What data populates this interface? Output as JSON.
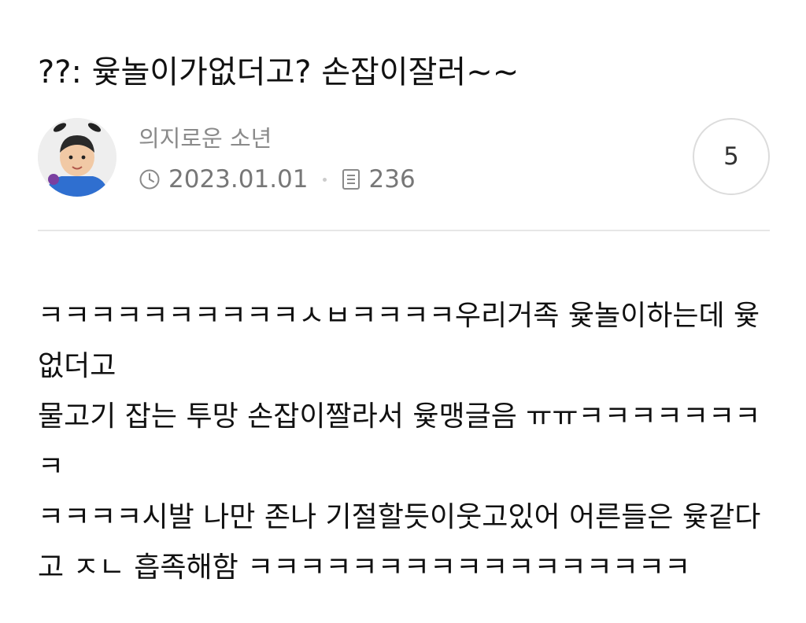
{
  "post": {
    "title": "??: 윷놀이가없더고? 손잡이잘러~~",
    "author": {
      "name": "의지로운 소년"
    },
    "date": "2023.01.01",
    "views": "236",
    "comment_count": "5",
    "body": [
      "ㅋㅋㅋㅋㅋㅋㅋㅋㅋㅋㅅㅂㅋㅋㅋㅋ우리거족 윷놀이하는데 윷없더고",
      "물고기 잡는 투망 손잡이짤라서 윷맹글음 ㅠㅠㅋㅋㅋㅋㅋㅋㅋㅋ",
      "ㅋㅋㅋㅋ시발 나만 존나 기절할듯이웃고있어 어른들은 윷같다고 ㅈㄴ 흡족해함 ㅋㅋㅋㅋㅋㅋㅋㅋㅋㅋㅋㅋㅋㅋㅋㅋㅋ"
    ]
  },
  "icons": {
    "date": "clock-icon",
    "views": "document-icon"
  },
  "colors": {
    "background": "#ffffff",
    "text": "#111111",
    "meta": "#777777",
    "divider": "#e6e6e6"
  }
}
